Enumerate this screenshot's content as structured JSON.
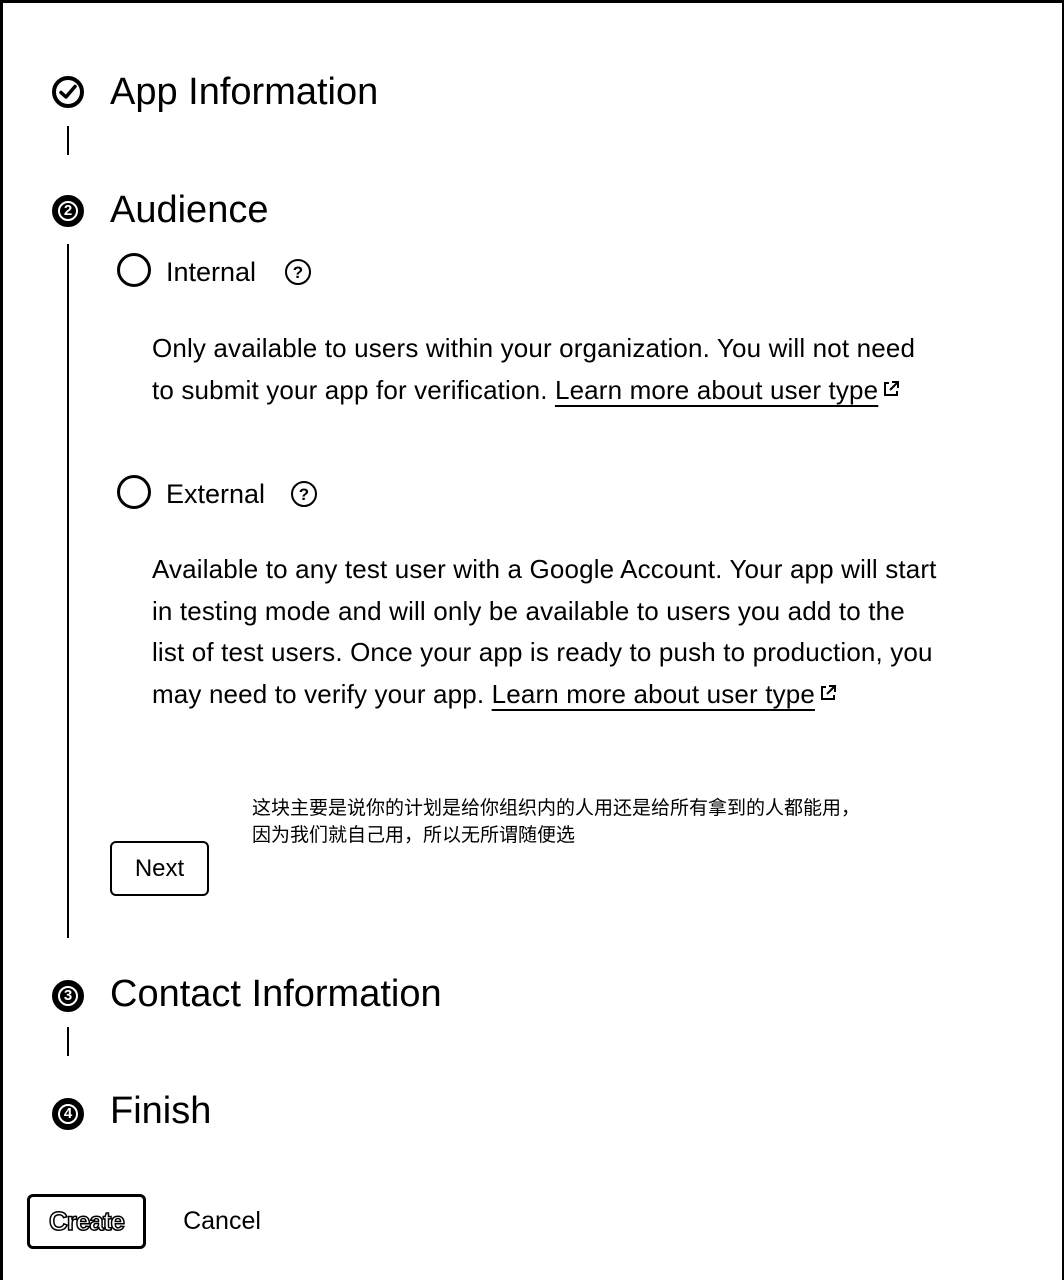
{
  "steps": [
    {
      "title": "App Information",
      "status": "completed",
      "icon": "check-circle-icon"
    },
    {
      "title": "Audience",
      "status": "active",
      "number": "2"
    },
    {
      "title": "Contact Information",
      "status": "pending",
      "number": "3"
    },
    {
      "title": "Finish",
      "status": "pending",
      "number": "4"
    }
  ],
  "audience": {
    "internal": {
      "label": "Internal",
      "help_icon": "help-icon",
      "description": "Only available to users within your organization. You will not need to submit your app for verification.",
      "link_text": "Learn more about user type"
    },
    "external": {
      "label": "External",
      "help_icon": "help-icon",
      "description": "Available to any test user with a Google Account. Your app will start in testing mode and will only be available to users you add to the list of test users. Once your app is ready to push to production, you may need to verify your app.",
      "link_text": "Learn more about user type"
    },
    "next_label": "Next"
  },
  "annotation": {
    "line1": "这块主要是说你的计划是给你组织内的人用还是给所有拿到的人都能用，",
    "line2": "因为我们就自己用，所以无所谓随便选"
  },
  "footer": {
    "create_label": "Create",
    "cancel_label": "Cancel"
  }
}
